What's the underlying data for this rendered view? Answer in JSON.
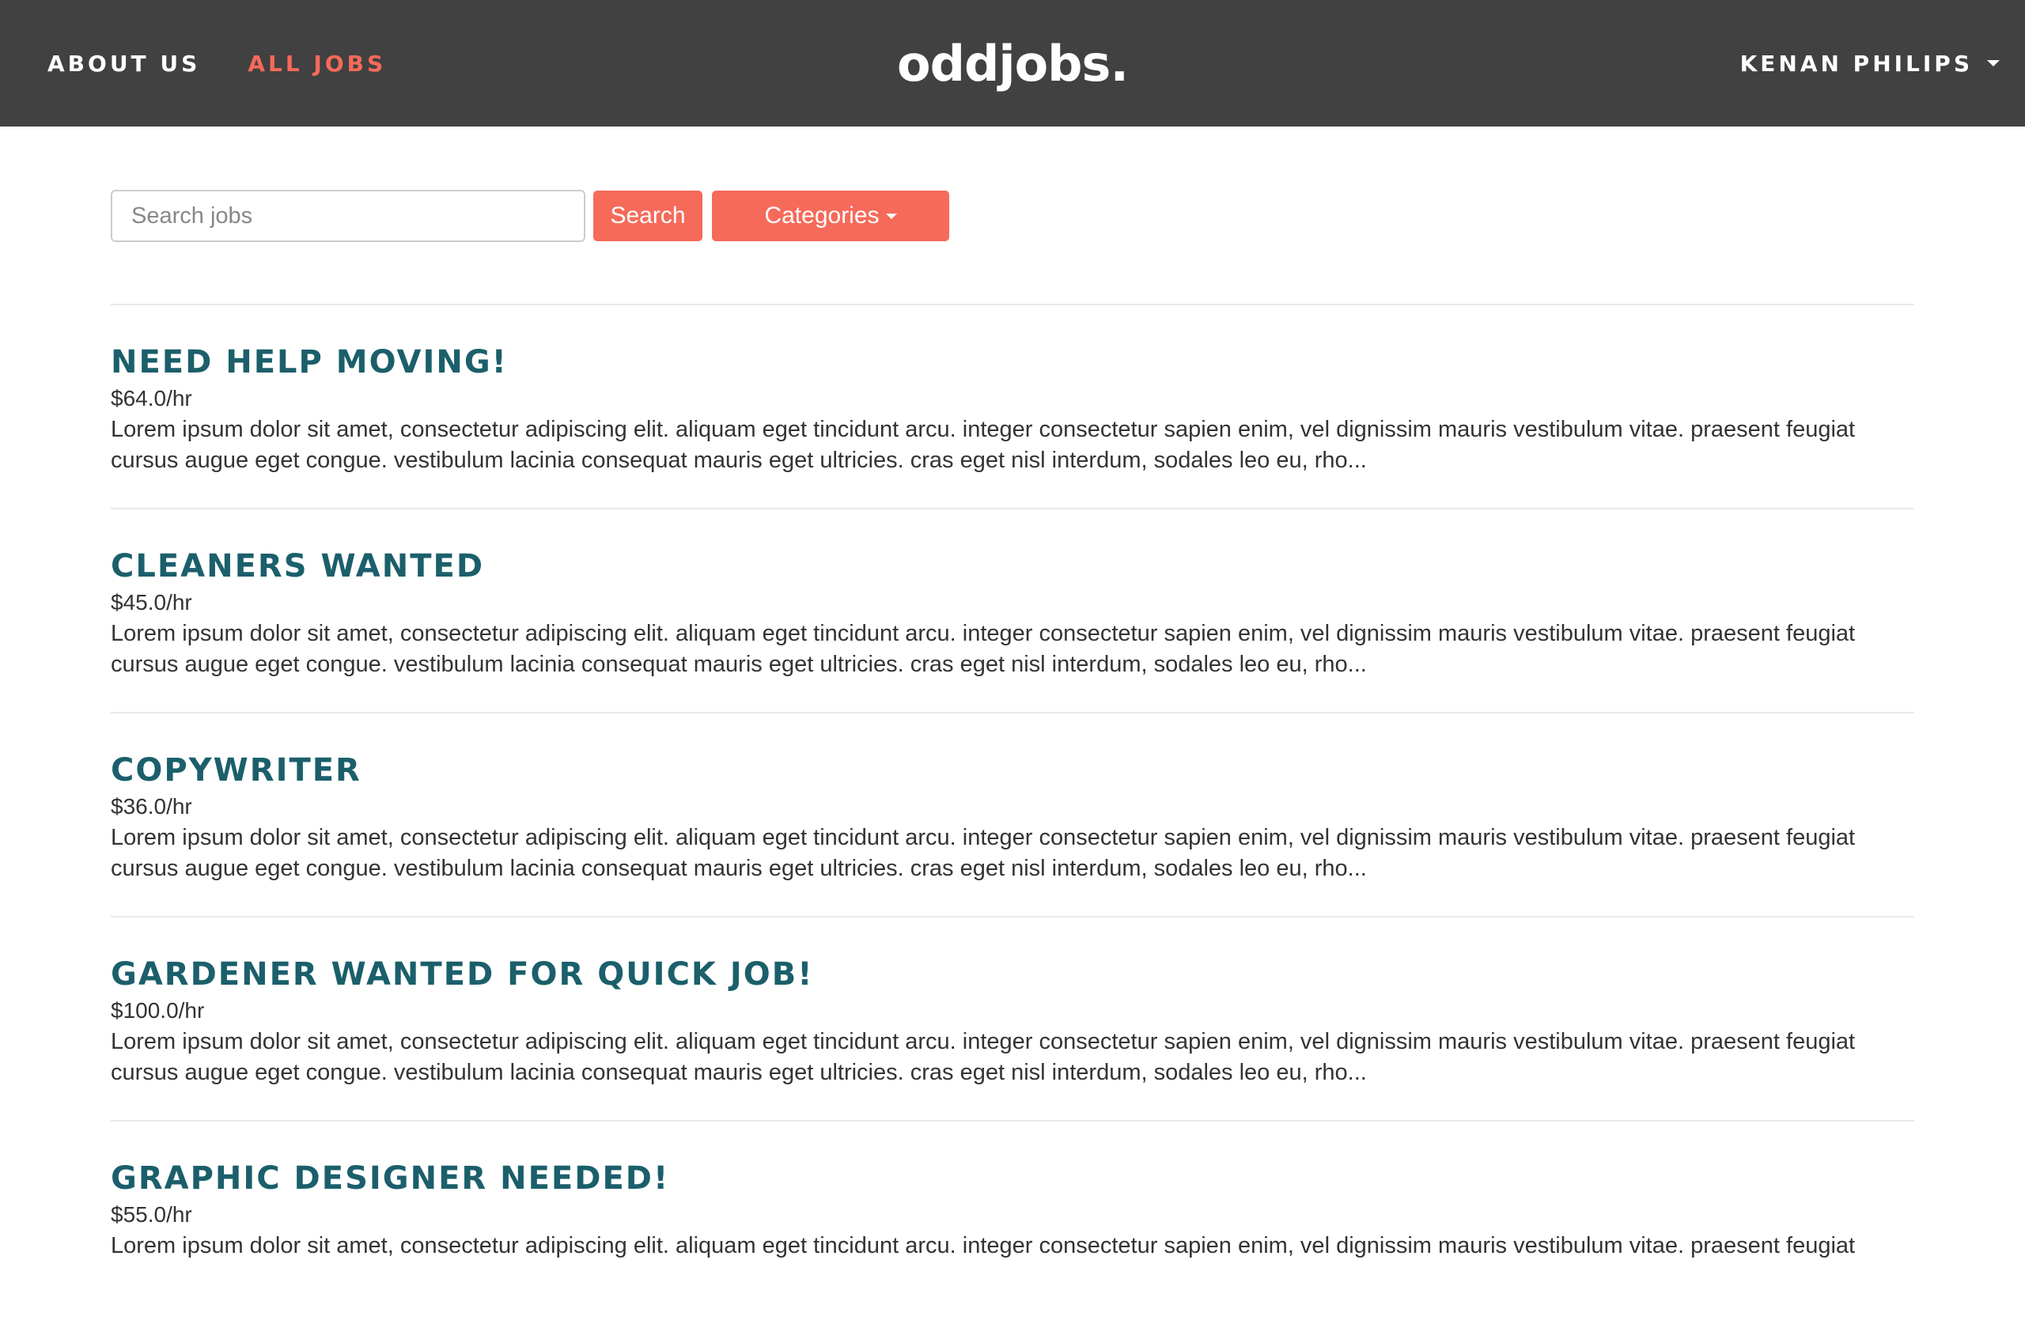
{
  "nav": {
    "links": [
      {
        "label": "ABOUT US",
        "active": false
      },
      {
        "label": "ALL JOBS",
        "active": true
      }
    ],
    "brand": "oddjobs.",
    "user": "KENAN PHILIPS"
  },
  "search": {
    "placeholder": "Search jobs",
    "value": "",
    "button_label": "Search",
    "categories_label": "Categories"
  },
  "jobs": [
    {
      "title": "NEED HELP MOVING!",
      "rate": "$64.0/hr",
      "description": "Lorem ipsum dolor sit amet, consectetur adipiscing elit. aliquam eget tincidunt arcu. integer consectetur sapien enim, vel dignissim mauris vestibulum vitae. praesent feugiat cursus augue eget congue. vestibulum lacinia consequat mauris eget ultricies. cras eget nisl interdum, sodales leo eu, rho..."
    },
    {
      "title": "CLEANERS WANTED",
      "rate": "$45.0/hr",
      "description": "Lorem ipsum dolor sit amet, consectetur adipiscing elit. aliquam eget tincidunt arcu. integer consectetur sapien enim, vel dignissim mauris vestibulum vitae. praesent feugiat cursus augue eget congue. vestibulum lacinia consequat mauris eget ultricies. cras eget nisl interdum, sodales leo eu, rho..."
    },
    {
      "title": "COPYWRITER",
      "rate": "$36.0/hr",
      "description": "Lorem ipsum dolor sit amet, consectetur adipiscing elit. aliquam eget tincidunt arcu. integer consectetur sapien enim, vel dignissim mauris vestibulum vitae. praesent feugiat cursus augue eget congue. vestibulum lacinia consequat mauris eget ultricies. cras eget nisl interdum, sodales leo eu, rho..."
    },
    {
      "title": "GARDENER WANTED FOR QUICK JOB!",
      "rate": "$100.0/hr",
      "description": "Lorem ipsum dolor sit amet, consectetur adipiscing elit. aliquam eget tincidunt arcu. integer consectetur sapien enim, vel dignissim mauris vestibulum vitae. praesent feugiat cursus augue eget congue. vestibulum lacinia consequat mauris eget ultricies. cras eget nisl interdum, sodales leo eu, rho..."
    },
    {
      "title": "GRAPHIC DESIGNER NEEDED!",
      "rate": "$55.0/hr",
      "description": "Lorem ipsum dolor sit amet, consectetur adipiscing elit. aliquam eget tincidunt arcu. integer consectetur sapien enim, vel dignissim mauris vestibulum vitae. praesent feugiat"
    }
  ],
  "colors": {
    "navbar_bg": "#414141",
    "accent": "#f66a5a",
    "job_title": "#1b5f6b",
    "text": "#333333"
  }
}
